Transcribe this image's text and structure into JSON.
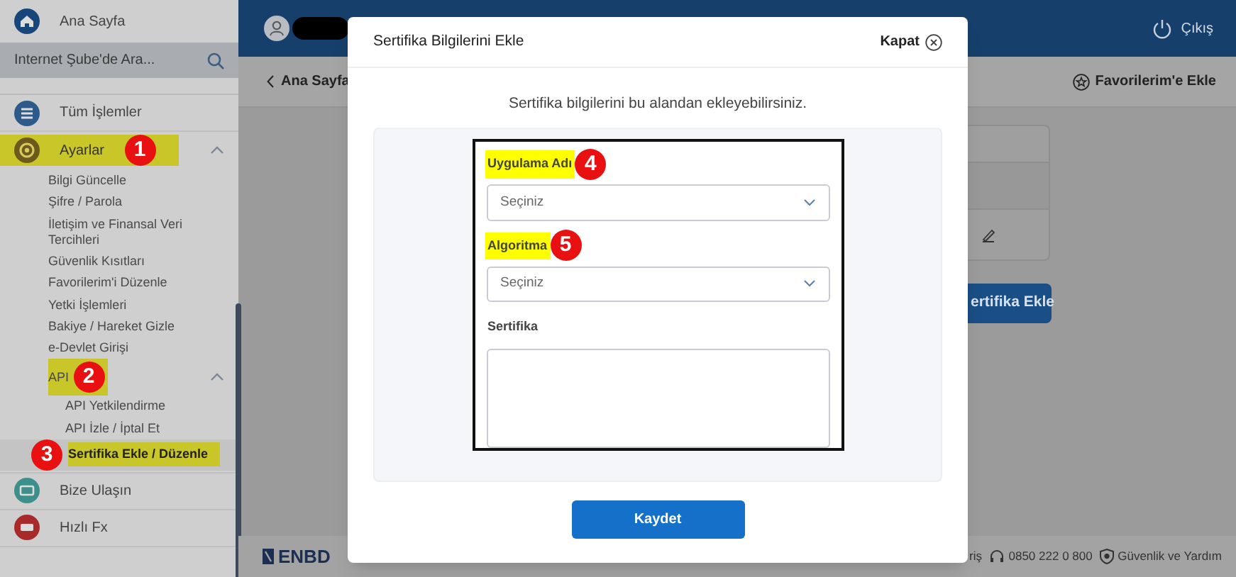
{
  "sidebar": {
    "home": {
      "label": "Ana Sayfa"
    },
    "search": {
      "placeholder": "Internet Şube'de Ara..."
    },
    "items": [
      {
        "label": "Tüm İşlemler",
        "kind": "list",
        "highlighted": false
      },
      {
        "label": "Ayarlar",
        "kind": "gear",
        "expanded": true,
        "highlighted": true,
        "marker": "1",
        "children": [
          {
            "label": "Bilgi Güncelle",
            "selected": false,
            "highlighted": false
          },
          {
            "label": "Şifre / Parola",
            "selected": false,
            "highlighted": false
          },
          {
            "label": "İletişim ve Finansal Veri Tercihleri",
            "selected": false,
            "highlighted": false
          },
          {
            "label": "Güvenlik Kısıtları",
            "selected": false,
            "highlighted": false
          },
          {
            "label": "Favorilerim'i Düzenle",
            "selected": false,
            "highlighted": false
          },
          {
            "label": "Yetki İşlemleri",
            "selected": false,
            "highlighted": false
          },
          {
            "label": "Bakiye / Hareket Gizle",
            "selected": false,
            "highlighted": false
          },
          {
            "label": "e-Devlet Girişi",
            "selected": false,
            "highlighted": false
          },
          {
            "label": "API",
            "highlighted": true,
            "marker": "2",
            "expanded": true,
            "children": [
              {
                "label": "API Yetkilendirme",
                "selected": false,
                "highlighted": false
              },
              {
                "label": "API İzle / İptal Et",
                "selected": false,
                "highlighted": false
              },
              {
                "label": "Sertifika Ekle / Düzenle",
                "selected": true,
                "highlighted": true,
                "marker": "3"
              }
            ]
          }
        ]
      },
      {
        "label": "Bize Ulaşın",
        "kind": "chat",
        "highlighted": false
      },
      {
        "label": "Hızlı Fx",
        "kind": "fx",
        "highlighted": false
      }
    ]
  },
  "header": {
    "logout": "Çıkış"
  },
  "subheader": {
    "back": "Ana Sayfa",
    "favorite": "Favorilerim'e Ekle"
  },
  "background_button": "ertifika Ekle",
  "footer": {
    "logo": "ENBD",
    "links": [
      {
        "kind": "text",
        "label": "riş"
      },
      {
        "kind": "phone",
        "label": "0850 222 0 800"
      },
      {
        "kind": "help",
        "label": "Güvenlik ve Yardım"
      }
    ]
  },
  "modal": {
    "title": "Sertifika Bilgilerini Ekle",
    "close": "Kapat",
    "intro": "Sertifika bilgilerini bu alandan ekleyebilirsiniz.",
    "fields": [
      {
        "kind": "select",
        "label": "Uygulama Adı",
        "placeholder": "Seçiniz",
        "highlighted": true,
        "marker": "4"
      },
      {
        "kind": "select",
        "label": "Algoritma",
        "placeholder": "Seçiniz",
        "highlighted": true,
        "marker": "5"
      },
      {
        "kind": "textarea",
        "label": "Sertifika",
        "highlighted": false
      }
    ],
    "submit": "Kaydet"
  }
}
